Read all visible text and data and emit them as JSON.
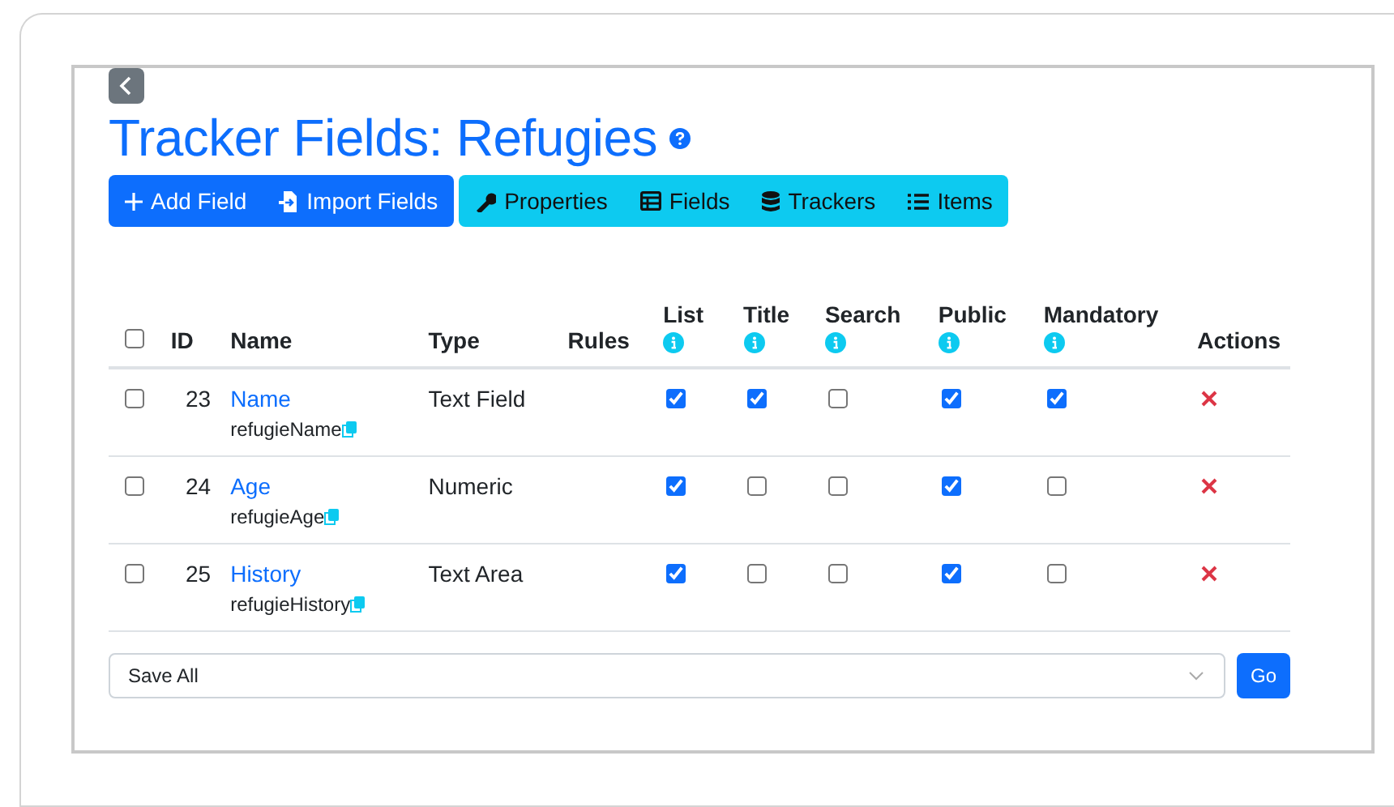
{
  "title": "Tracker Fields: Refugies",
  "toolbar_primary": [
    {
      "kind": "add",
      "label": "Add Field"
    },
    {
      "kind": "import",
      "label": "Import Fields"
    }
  ],
  "toolbar_secondary": [
    {
      "kind": "wrench",
      "label": "Properties"
    },
    {
      "kind": "table",
      "label": "Fields"
    },
    {
      "kind": "database",
      "label": "Trackers"
    },
    {
      "kind": "list",
      "label": "Items"
    }
  ],
  "table": {
    "select_all": {
      "checked": false
    },
    "columns": [
      {
        "label": "ID",
        "info": false
      },
      {
        "label": "Name",
        "info": false
      },
      {
        "label": "Type",
        "info": false
      },
      {
        "label": "Rules",
        "info": false
      },
      {
        "label": "List",
        "info": true
      },
      {
        "label": "Title",
        "info": true
      },
      {
        "label": "Search",
        "info": true
      },
      {
        "label": "Public",
        "info": true
      },
      {
        "label": "Mandatory",
        "info": true
      },
      {
        "label": "Actions",
        "info": false
      }
    ],
    "rows": [
      {
        "checked": false,
        "id": "23",
        "name": "Name",
        "perm_name": "refugieName",
        "type": "Text Field",
        "flags": [
          {
            "checked": true
          },
          {
            "checked": true
          },
          {
            "checked": false
          },
          {
            "checked": true
          },
          {
            "checked": true
          }
        ]
      },
      {
        "checked": false,
        "id": "24",
        "name": "Age",
        "perm_name": "refugieAge",
        "type": "Numeric",
        "flags": [
          {
            "checked": true
          },
          {
            "checked": false
          },
          {
            "checked": false
          },
          {
            "checked": true
          },
          {
            "checked": false
          }
        ]
      },
      {
        "checked": false,
        "id": "25",
        "name": "History",
        "perm_name": "refugieHistory",
        "type": "Text Area",
        "flags": [
          {
            "checked": true
          },
          {
            "checked": false
          },
          {
            "checked": false
          },
          {
            "checked": true
          },
          {
            "checked": false
          }
        ]
      }
    ]
  },
  "bulk_action": {
    "value": "Save All"
  },
  "go_button": "Go"
}
